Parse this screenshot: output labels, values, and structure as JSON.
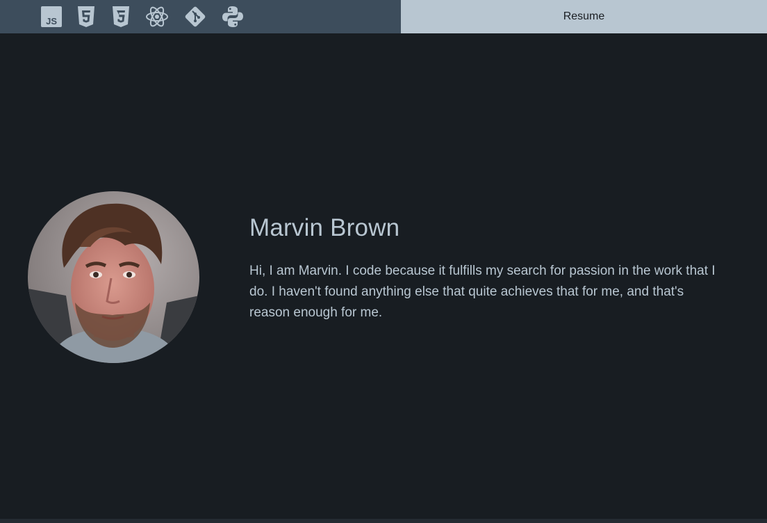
{
  "nav": {
    "icons": [
      "javascript-icon",
      "html5-icon",
      "css3-icon",
      "react-icon",
      "git-icon",
      "python-icon"
    ],
    "resume_label": "Resume",
    "icon_color": "#b8c6d1",
    "bar_color": "#3d4d5c",
    "tab_color": "#b8c6d1"
  },
  "profile": {
    "name": "Marvin Brown",
    "bio": "Hi, I am Marvin. I code because it fulfills my search for passion in the work that I do. I haven't found anything else that quite achieves that for me, and that's reason enough for me."
  },
  "colors": {
    "background": "#181d22",
    "text": "#b8c6d1"
  }
}
